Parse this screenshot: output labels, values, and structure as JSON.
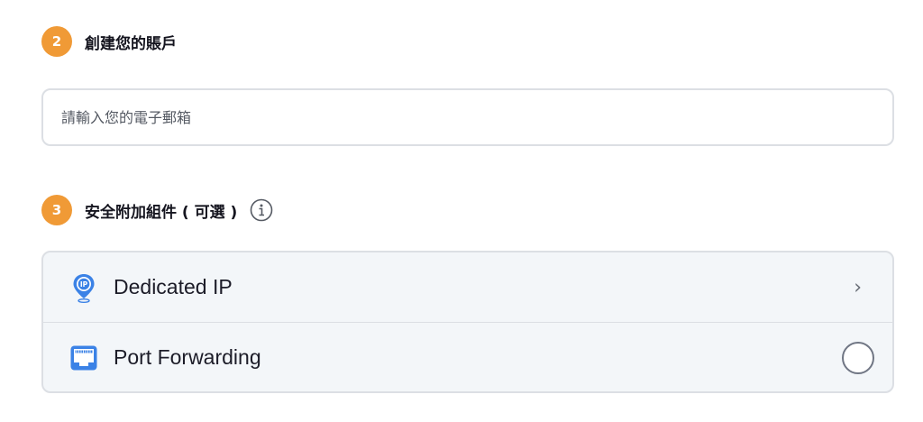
{
  "step2": {
    "number": "2",
    "title": "創建您的賬戶"
  },
  "email": {
    "placeholder": "請輸入您的電子郵箱"
  },
  "step3": {
    "number": "3",
    "title": "安全附加組件 ( 可選 )",
    "info_icon": "info-icon"
  },
  "addons": [
    {
      "label": "Dedicated IP",
      "icon": "dedicated-ip-pin-icon",
      "control": "chevron-right-icon"
    },
    {
      "label": "Port Forwarding",
      "icon": "ethernet-port-icon",
      "control": "radio",
      "selected": false
    }
  ],
  "colors": {
    "badge": "#f09a36",
    "border": "#dcdfe4",
    "addon_bg": "#f3f6f9",
    "icon_blue": "#3b82e6"
  }
}
